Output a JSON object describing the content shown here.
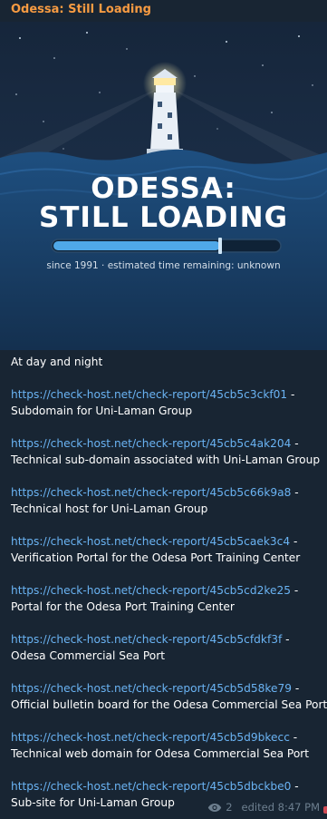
{
  "channel": {
    "title": "Odessa: Still Loading"
  },
  "banner": {
    "line1": "ODESSA:",
    "line2": "STILL LOADING",
    "caption": "since 1991 · estimated time remaining: unknown",
    "progress_fraction": 0.74,
    "colors": {
      "sky": "#1a2b42",
      "sea": "#1d4d7d",
      "progress": "#4fa8e8"
    }
  },
  "message": {
    "intro": "At day and night",
    "entries": [
      {
        "url": "https://check-host.net/check-report/45cb5c3ckf01",
        "desc": "Subdomain for Uni-Laman Group"
      },
      {
        "url": "https://check-host.net/check-report/45cb5c4ak204",
        "desc": "Technical sub-domain associated with Uni-Laman Group"
      },
      {
        "url": "https://check-host.net/check-report/45cb5c66k9a8",
        "desc": "Technical host for Uni-Laman Group"
      },
      {
        "url": "https://check-host.net/check-report/45cb5caek3c4",
        "desc": "Verification Portal for the Odesa Port Training Center"
      },
      {
        "url": "https://check-host.net/check-report/45cb5cd2ke25",
        "desc": "Portal for the Odesa Port Training Center"
      },
      {
        "url": "https://check-host.net/check-report/45cb5cfdkf3f",
        "desc": "Odesa Commercial Sea Port"
      },
      {
        "url": "https://check-host.net/check-report/45cb5d58ke79",
        "desc": "Official bulletin board for the Odesa Commercial Sea Port"
      },
      {
        "url": "https://check-host.net/check-report/45cb5d9bkecc",
        "desc": "Technical web domain for Odesa Commercial Sea Port"
      },
      {
        "url": "https://check-host.net/check-report/45cb5dbckbe0",
        "desc": "Sub-site for Uni-Laman Group"
      }
    ],
    "separator": " -"
  },
  "meta": {
    "views": "2",
    "edited": "edited 8:47 PM",
    "icon": "eye-icon"
  }
}
